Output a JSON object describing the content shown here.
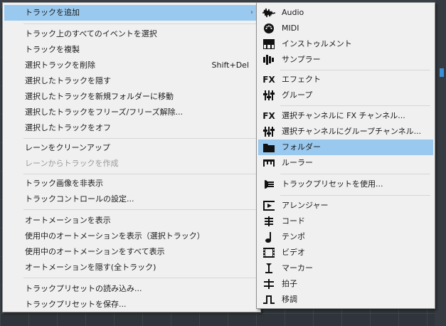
{
  "main_menu": {
    "items": [
      {
        "label": "トラックを追加",
        "submenu": true
      },
      {
        "label": "トラック上のすべてのイベントを選択"
      },
      {
        "label": "トラックを複製"
      },
      {
        "label": "選択トラックを削除",
        "shortcut": "Shift+Del"
      },
      {
        "label": "選択したトラックを隠す"
      },
      {
        "label": "選択したトラックを新規フォルダーに移動"
      },
      {
        "label": "選択したトラックをフリーズ/フリーズ解除..."
      },
      {
        "label": "選択したトラックをオフ"
      },
      {
        "label": "レーンをクリーンアップ"
      },
      {
        "label": "レーンからトラックを作成",
        "disabled": true
      },
      {
        "label": "トラック画像を非表示"
      },
      {
        "label": "トラックコントロールの設定..."
      },
      {
        "label": "オートメーションを表示"
      },
      {
        "label": "使用中のオートメーションを表示（選択トラック）"
      },
      {
        "label": "使用中のオートメーションをすべて表示"
      },
      {
        "label": "オートメーションを隠す(全トラック)"
      },
      {
        "label": "トラックプリセットの読み込み..."
      },
      {
        "label": "トラックプリセットを保存..."
      }
    ]
  },
  "sub_menu": {
    "items": [
      {
        "label": "Audio",
        "icon": "audio-waveform-icon"
      },
      {
        "label": "MIDI",
        "icon": "midi-connector-icon"
      },
      {
        "label": "インストゥルメント",
        "icon": "piano-keys-icon"
      },
      {
        "label": "サンプラー",
        "icon": "sampler-icon"
      },
      {
        "label": "エフェクト",
        "icon": "fx-icon"
      },
      {
        "label": "グループ",
        "icon": "group-faders-icon"
      },
      {
        "label": "選択チャンネルに FX チャンネル...",
        "icon": "fx-icon"
      },
      {
        "label": "選択チャンネルにグループチャンネル...",
        "icon": "group-faders-icon"
      },
      {
        "label": "フォルダー",
        "icon": "folder-icon",
        "highlight": true
      },
      {
        "label": "ルーラー",
        "icon": "ruler-icon"
      },
      {
        "label": "トラックプリセットを使用...",
        "icon": "track-preset-icon"
      },
      {
        "label": "アレンジャー",
        "icon": "arranger-icon"
      },
      {
        "label": "コード",
        "icon": "chord-icon"
      },
      {
        "label": "テンポ",
        "icon": "tempo-note-icon"
      },
      {
        "label": "ビデオ",
        "icon": "video-film-icon"
      },
      {
        "label": "マーカー",
        "icon": "marker-icon"
      },
      {
        "label": "拍子",
        "icon": "signature-icon"
      },
      {
        "label": "移調",
        "icon": "transpose-icon"
      }
    ],
    "fx_glyph": "FX"
  },
  "colors": {
    "menu_bg": "#f0f0f0",
    "highlight": "#99c9ef",
    "disabled_text": "#9a9a9a",
    "project_bg": "#2f353a"
  }
}
